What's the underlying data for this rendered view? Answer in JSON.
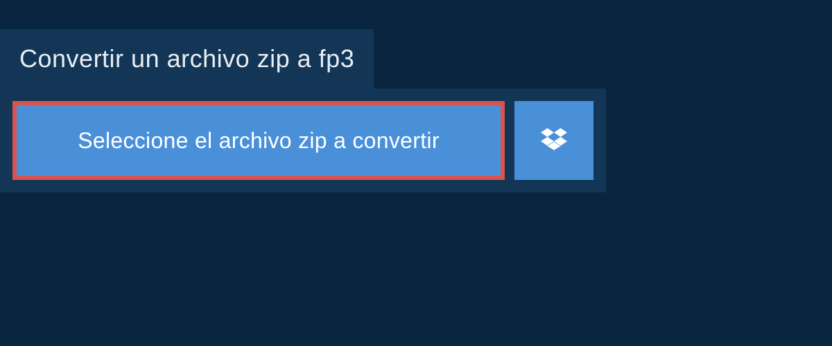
{
  "header": {
    "title": "Convertir un archivo zip a fp3"
  },
  "actions": {
    "select_file_label": "Seleccione el archivo zip a convertir",
    "dropbox_icon": "dropbox-icon"
  },
  "colors": {
    "page_bg": "#0a2540",
    "panel_bg": "#133656",
    "button_bg": "#4a90d9",
    "highlight_border": "#d9534f",
    "text_light": "#e8eef4",
    "text_white": "#ffffff"
  }
}
